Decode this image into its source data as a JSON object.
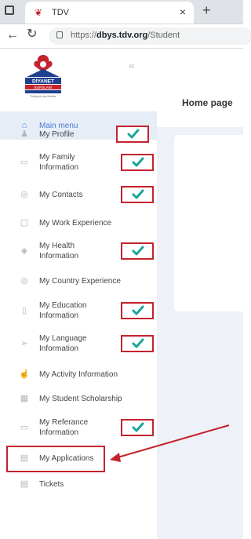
{
  "browser": {
    "tab_title": "TDV",
    "url_prefix": "https://",
    "url_domain": "dbys.tdv.org",
    "url_path": "/Student"
  },
  "sidebar": {
    "logo_text_top": "DİYANET",
    "logo_text_mid": "BURSLARI",
    "logo_text_bottom": "Türkiye'ye Hoş Geldiniz",
    "collapse_glyph": "«",
    "items": [
      {
        "label": "Main menu",
        "icon": "home-icon",
        "active": true
      },
      {
        "label": "My Profile",
        "icon": "user-icon",
        "checked": true
      },
      {
        "label": "My Family\nInformation",
        "icon": "folder-icon",
        "checked": true
      },
      {
        "label": "My Contacts",
        "icon": "globe-icon",
        "checked": true
      },
      {
        "label": "My Work Experience",
        "icon": "briefcase-icon"
      },
      {
        "label": "My Health\nInformation",
        "icon": "eye-icon",
        "checked": true
      },
      {
        "label": "My Country Experience",
        "icon": "globe-icon"
      },
      {
        "label": "My Education\nInformation",
        "icon": "book-icon",
        "checked": true
      },
      {
        "label": "My Language\nInformation",
        "icon": "send-icon",
        "checked": true
      },
      {
        "label": "My Activity Information",
        "icon": "thumbs-up-icon"
      },
      {
        "label": "My Student Scholarship",
        "icon": "calendar-icon"
      },
      {
        "label": "My Referance\nInformation",
        "icon": "folder-icon",
        "checked": true
      },
      {
        "label": "My Applications",
        "icon": "inbox-icon",
        "highlighted": true
      },
      {
        "label": "Tickets",
        "icon": "inbox-icon"
      }
    ]
  },
  "main": {
    "page_title": "Home page"
  },
  "colors": {
    "annotation_red": "#c4232d",
    "check_teal": "#1aa59a",
    "active_blue": "#4a7bd0"
  }
}
